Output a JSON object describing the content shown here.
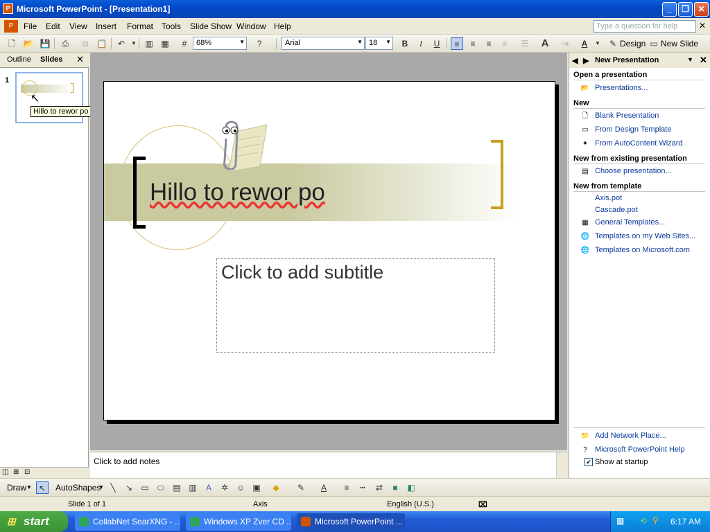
{
  "window": {
    "title": "Microsoft PowerPoint - [Presentation1]",
    "app_icon": "P"
  },
  "menu": {
    "items": [
      "File",
      "Edit",
      "View",
      "Insert",
      "Format",
      "Tools",
      "Slide Show",
      "Window",
      "Help"
    ],
    "ask_placeholder": "Type a question for help"
  },
  "toolbar": {
    "zoom": "68%",
    "font": "Arial",
    "size": "18",
    "bold": "B",
    "italic": "I",
    "underline": "U",
    "design_label": "Design",
    "new_slide_label": "New Slide"
  },
  "left_pane": {
    "tab_outline": "Outline",
    "tab_slides": "Slides",
    "slide_number": "1",
    "tooltip": "Hillo to rewor po"
  },
  "slide": {
    "title": "Hillo to rewor po",
    "subtitle_placeholder": "Click to add subtitle"
  },
  "notes": {
    "placeholder": "Click to add notes"
  },
  "task_pane": {
    "title": "New Presentation",
    "open_header": "Open a presentation",
    "open_items": [
      "Presentations..."
    ],
    "new_header": "New",
    "new_items": [
      "Blank Presentation",
      "From Design Template",
      "From AutoContent Wizard"
    ],
    "existing_header": "New from existing presentation",
    "existing_items": [
      "Choose presentation..."
    ],
    "template_header": "New from template",
    "template_items": [
      "Axis.pot",
      "Cascade.pot",
      "General Templates...",
      "Templates on my Web Sites...",
      "Templates on Microsoft.com"
    ],
    "bottom_items": [
      "Add Network Place...",
      "Microsoft PowerPoint Help"
    ],
    "show_startup": "Show at startup"
  },
  "drawbar": {
    "draw_label": "Draw",
    "autoshapes_label": "AutoShapes"
  },
  "status": {
    "slide_info": "Slide 1 of 1",
    "design": "Axis",
    "language": "English (U.S.)"
  },
  "taskbar": {
    "start_label": "start",
    "tasks": [
      "CollabNet SearXNG - ...",
      "Windows XP Zver CD ...",
      "Microsoft PowerPoint ..."
    ],
    "clock": "6:17 AM"
  }
}
